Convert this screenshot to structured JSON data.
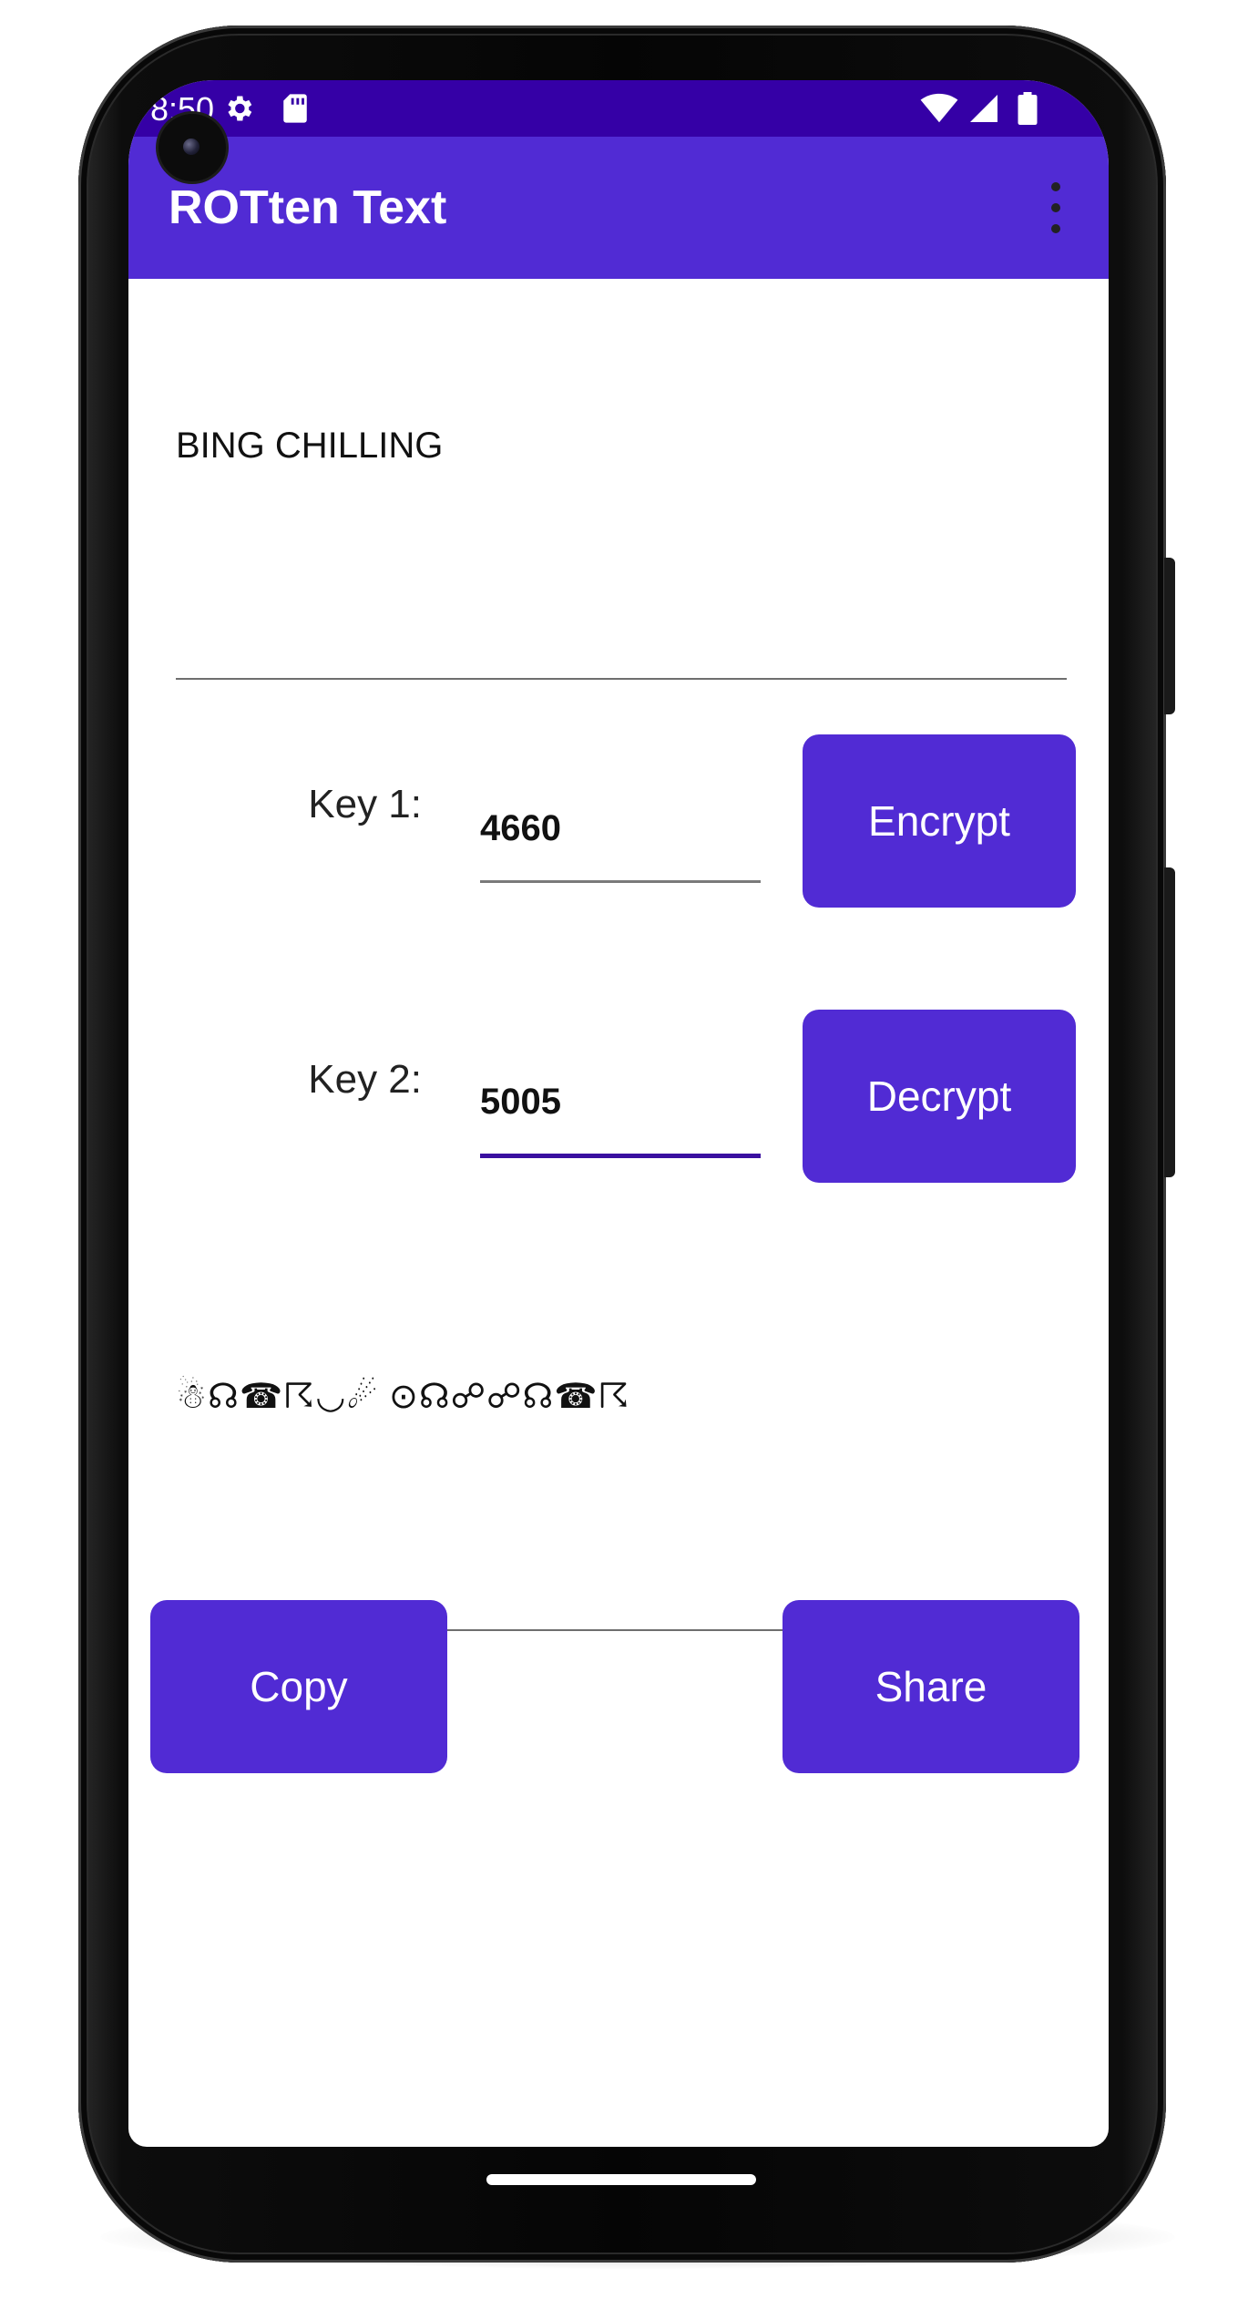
{
  "status_bar": {
    "time": "8:50",
    "icons": [
      "settings-gear-icon",
      "sd-card-icon",
      "wifi-icon",
      "cell-signal-icon",
      "battery-icon"
    ]
  },
  "app_bar": {
    "title": "ROTten Text",
    "menu_icon": "more-vert-icon"
  },
  "input_editor": {
    "value": "BING CHILLING"
  },
  "keys": [
    {
      "label": "Key 1:",
      "value": "4660"
    },
    {
      "label": "Key 2:",
      "value": "5005"
    }
  ],
  "buttons": {
    "encrypt": "Encrypt",
    "decrypt": "Decrypt",
    "copy": "Copy",
    "share": "Share"
  },
  "output_editor": {
    "value": "☃☊☎☈◡☄ ⊙☊☍☍☊☎☈"
  },
  "colors": {
    "primary": "#512bd4",
    "status_bar": "#3500a6",
    "focused_underline": "#3a10a0"
  }
}
